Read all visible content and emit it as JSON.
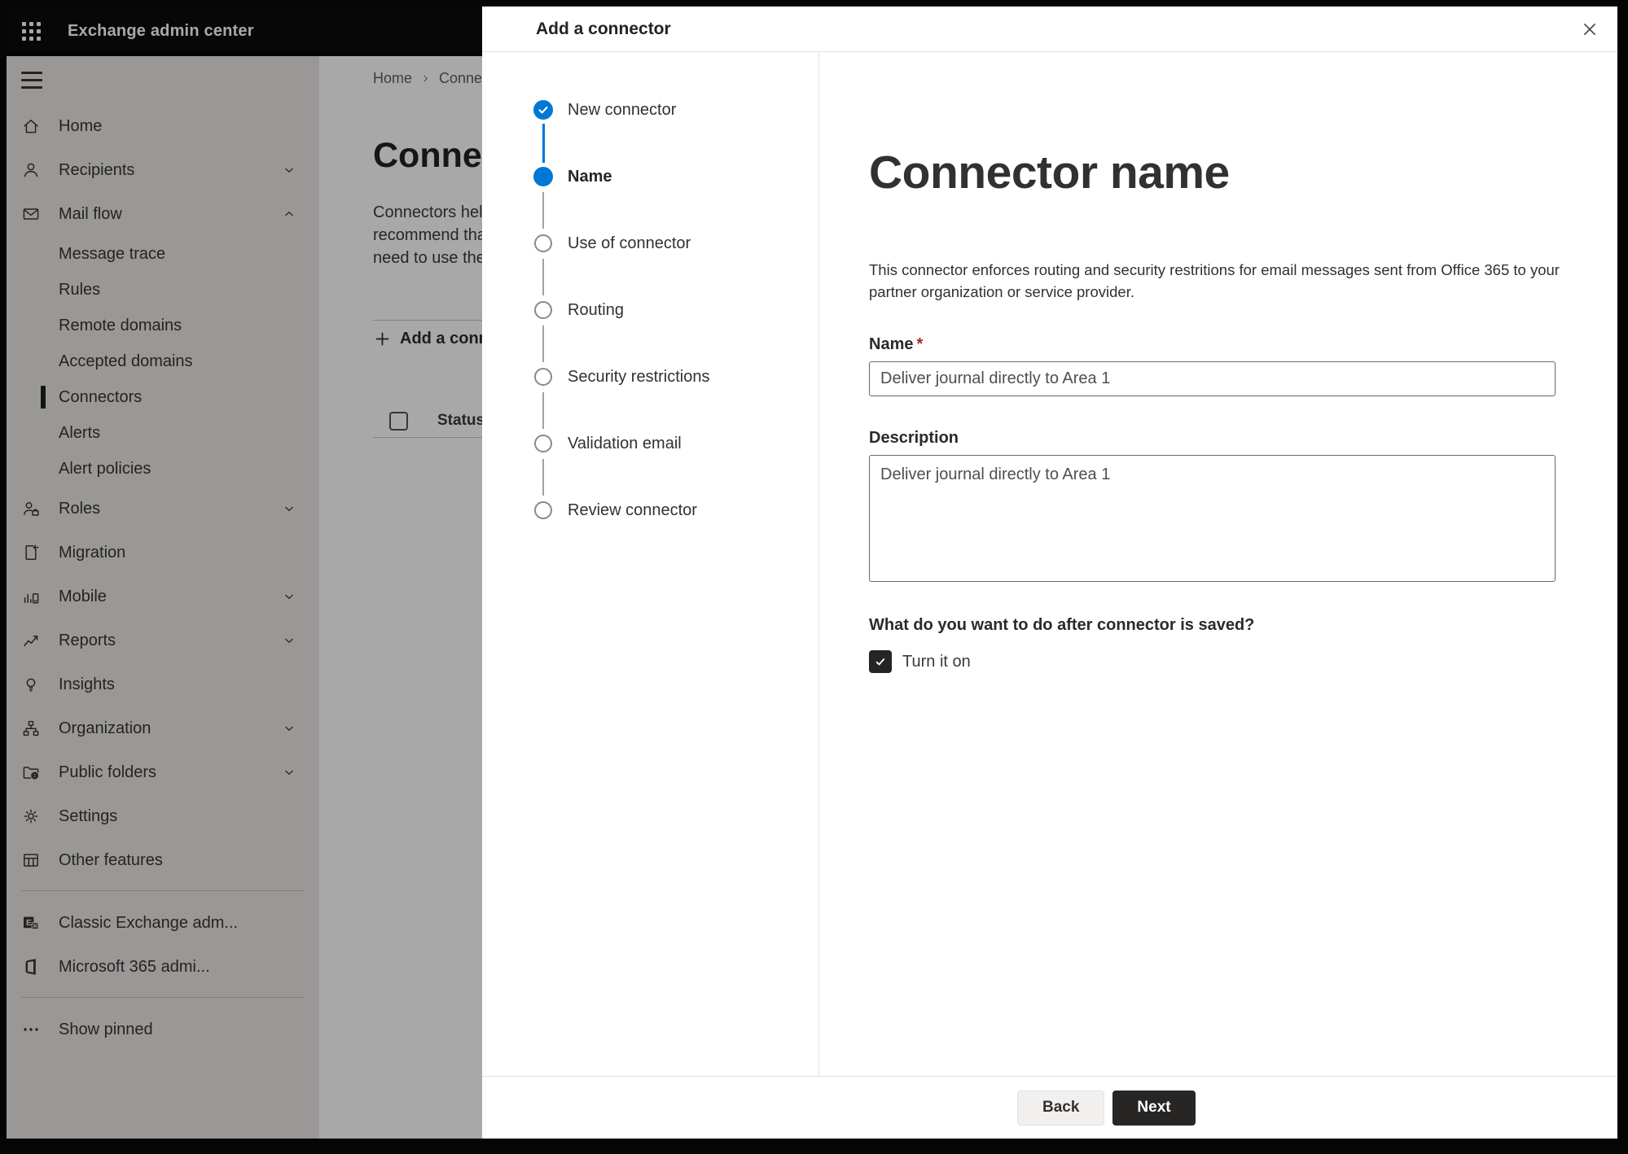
{
  "top_bar": {
    "title": "Exchange admin center"
  },
  "sidebar": {
    "items": [
      {
        "label": "Home",
        "icon": "home",
        "type": "top"
      },
      {
        "label": "Recipients",
        "icon": "person",
        "type": "top",
        "chevron": "down"
      },
      {
        "label": "Mail flow",
        "icon": "mail",
        "type": "top",
        "chevron": "up"
      },
      {
        "label": "Message trace",
        "type": "sub"
      },
      {
        "label": "Rules",
        "type": "sub"
      },
      {
        "label": "Remote domains",
        "type": "sub"
      },
      {
        "label": "Accepted domains",
        "type": "sub"
      },
      {
        "label": "Connectors",
        "type": "sub",
        "selected": true
      },
      {
        "label": "Alerts",
        "type": "sub"
      },
      {
        "label": "Alert policies",
        "type": "sub"
      },
      {
        "label": "Roles",
        "icon": "roles",
        "type": "top",
        "chevron": "down"
      },
      {
        "label": "Migration",
        "icon": "migration",
        "type": "top"
      },
      {
        "label": "Mobile",
        "icon": "mobile",
        "type": "top",
        "chevron": "down"
      },
      {
        "label": "Reports",
        "icon": "reports",
        "type": "top",
        "chevron": "down"
      },
      {
        "label": "Insights",
        "icon": "insights",
        "type": "top"
      },
      {
        "label": "Organization",
        "icon": "organization",
        "type": "top",
        "chevron": "down"
      },
      {
        "label": "Public folders",
        "icon": "public-folders",
        "type": "top",
        "chevron": "down"
      },
      {
        "label": "Settings",
        "icon": "settings",
        "type": "top"
      },
      {
        "label": "Other features",
        "icon": "other-features",
        "type": "top"
      },
      {
        "divider": true
      },
      {
        "label": "Classic Exchange adm...",
        "icon": "classic-exchange",
        "type": "top"
      },
      {
        "label": "Microsoft 365 admi...",
        "icon": "m365",
        "type": "top"
      },
      {
        "divider": true
      },
      {
        "label": "Show pinned",
        "icon": "ellipsis",
        "type": "top"
      }
    ]
  },
  "page": {
    "breadcrumb": {
      "home": "Home",
      "current": "Connectors"
    },
    "title": "Connectors",
    "description_lines": [
      "Connectors help",
      "recommend that",
      "need to use ther"
    ],
    "add_button_label": "Add a connector",
    "table": {
      "status_header": "Status"
    }
  },
  "dialog": {
    "title": "Add a connector",
    "steps": [
      {
        "label": "New connector",
        "state": "completed"
      },
      {
        "label": "Name",
        "state": "current"
      },
      {
        "label": "Use of connector",
        "state": "upcoming"
      },
      {
        "label": "Routing",
        "state": "upcoming"
      },
      {
        "label": "Security restrictions",
        "state": "upcoming"
      },
      {
        "label": "Validation email",
        "state": "upcoming"
      },
      {
        "label": "Review connector",
        "state": "upcoming"
      }
    ],
    "content": {
      "heading": "Connector name",
      "description": "This connector enforces routing and security restritions for email messages sent from Office 365 to your partner organization or service provider.",
      "name_label": "Name",
      "required_marker": "*",
      "name_value": "Deliver journal directly to Area 1",
      "description_label": "Description",
      "description_value": "Deliver journal directly to Area 1",
      "after_save_question": "What do you want to do after connector is saved?",
      "turn_on_label": "Turn it on",
      "turn_on_checked": true
    },
    "footer": {
      "back_label": "Back",
      "next_label": "Next"
    }
  },
  "colors": {
    "accent": "#0078d4",
    "required_marker": "#a4262c",
    "topbar": "#0b0b0b",
    "checkbox_fill": "#262524",
    "next_button": "#272625",
    "selected_indicator": "#21201f"
  }
}
